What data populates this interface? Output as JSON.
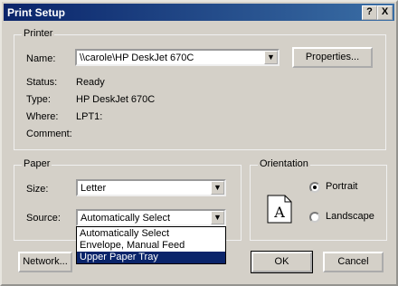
{
  "dialog": {
    "title": "Print Setup",
    "help_button": "?",
    "close_button": "X"
  },
  "printer": {
    "legend": "Printer",
    "name_label": "Name:",
    "name_value": "\\\\carole\\HP DeskJet 670C",
    "properties_button": "Properties...",
    "status_label": "Status:",
    "status_value": "Ready",
    "type_label": "Type:",
    "type_value": "HP DeskJet 670C",
    "where_label": "Where:",
    "where_value": "LPT1:",
    "comment_label": "Comment:",
    "comment_value": ""
  },
  "paper": {
    "legend": "Paper",
    "size_label": "Size:",
    "size_value": "Letter",
    "source_label": "Source:",
    "source_value": "Automatically Select",
    "source_options": [
      "Automatically Select",
      "Envelope, Manual Feed",
      "Upper Paper Tray"
    ],
    "highlighted_option": "Upper Paper Tray"
  },
  "orientation": {
    "legend": "Orientation",
    "icon_letter": "A",
    "portrait_label": "Portrait",
    "landscape_label": "Landscape",
    "selected": "Portrait"
  },
  "buttons": {
    "network": "Network...",
    "ok": "OK",
    "cancel": "Cancel"
  }
}
